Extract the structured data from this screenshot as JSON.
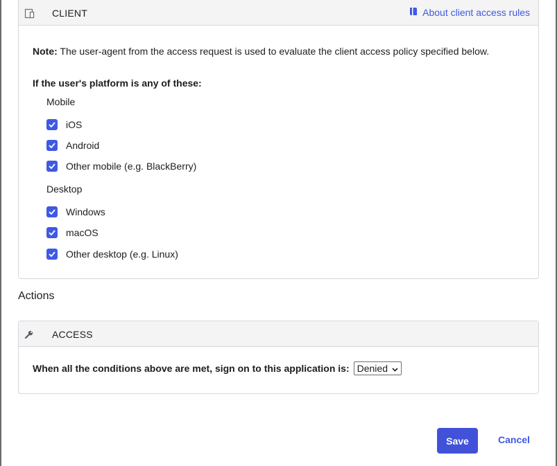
{
  "client": {
    "title": "CLIENT",
    "link_label": "About client access rules",
    "icon": "device-icon",
    "note_label": "Note:",
    "note_text": " The user-agent from the access request is used to evaluate the client access policy specified below.",
    "platform_question": "If the user's platform is any of these:",
    "mobile_label": "Mobile",
    "mobile_options": [
      {
        "label": "iOS",
        "checked": true
      },
      {
        "label": "Android",
        "checked": true
      },
      {
        "label": "Other mobile (e.g. BlackBerry)",
        "checked": true
      }
    ],
    "desktop_label": "Desktop",
    "desktop_options": [
      {
        "label": "Windows",
        "checked": true
      },
      {
        "label": "macOS",
        "checked": true
      },
      {
        "label": "Other desktop (e.g. Linux)",
        "checked": true
      }
    ]
  },
  "actions": {
    "heading": "Actions",
    "access_title": "ACCESS",
    "access_icon": "wrench-icon",
    "condition_text": "When all the conditions above are met, sign on to this application is:",
    "access_value": "Denied"
  },
  "footer": {
    "save_label": "Save",
    "cancel_label": "Cancel"
  },
  "colors": {
    "accent": "#3f59e4",
    "button": "#4152d9"
  }
}
